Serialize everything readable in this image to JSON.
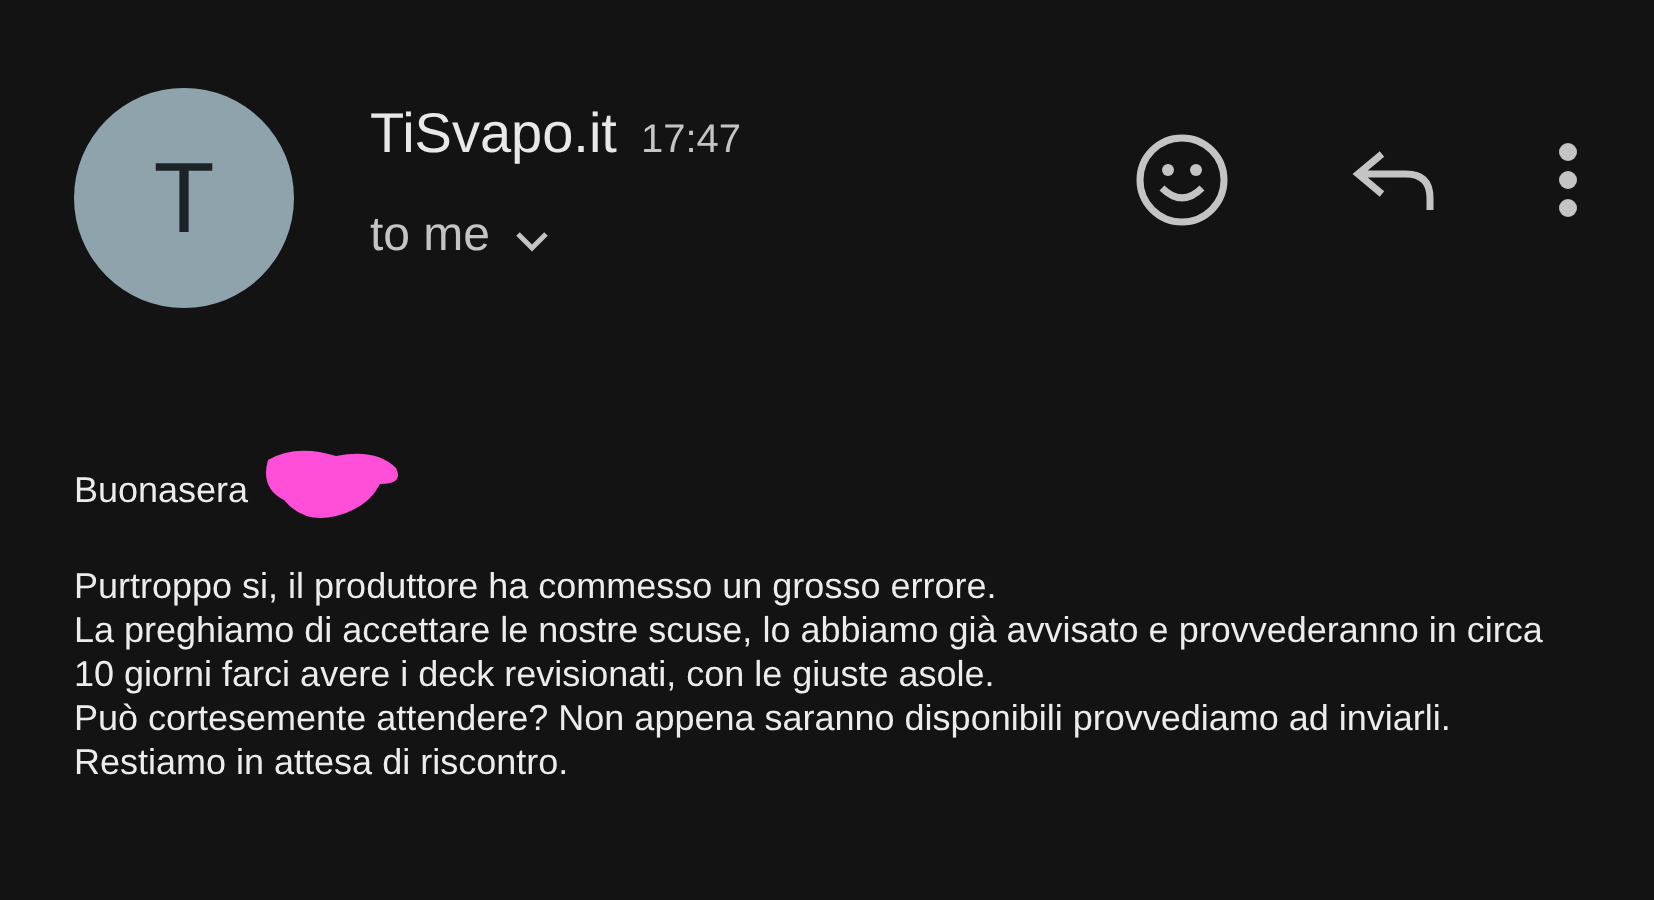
{
  "sender": {
    "avatar_letter": "T",
    "name": "TiSvapo.it",
    "time": "17:47",
    "recipient": "to me"
  },
  "body": {
    "greeting": "Buonasera",
    "paragraphs": [
      "Purtroppo si, il produttore ha commesso un grosso errore.",
      "La preghiamo di accettare le nostre scuse, lo abbiamo già avvisato e provvederanno in circa 10 giorni farci avere i deck revisionati, con le giuste asole.",
      "Può cortesemente attendere? Non appena saranno disponibili provvediamo ad inviarli.",
      "Restiamo in attesa di riscontro."
    ]
  }
}
